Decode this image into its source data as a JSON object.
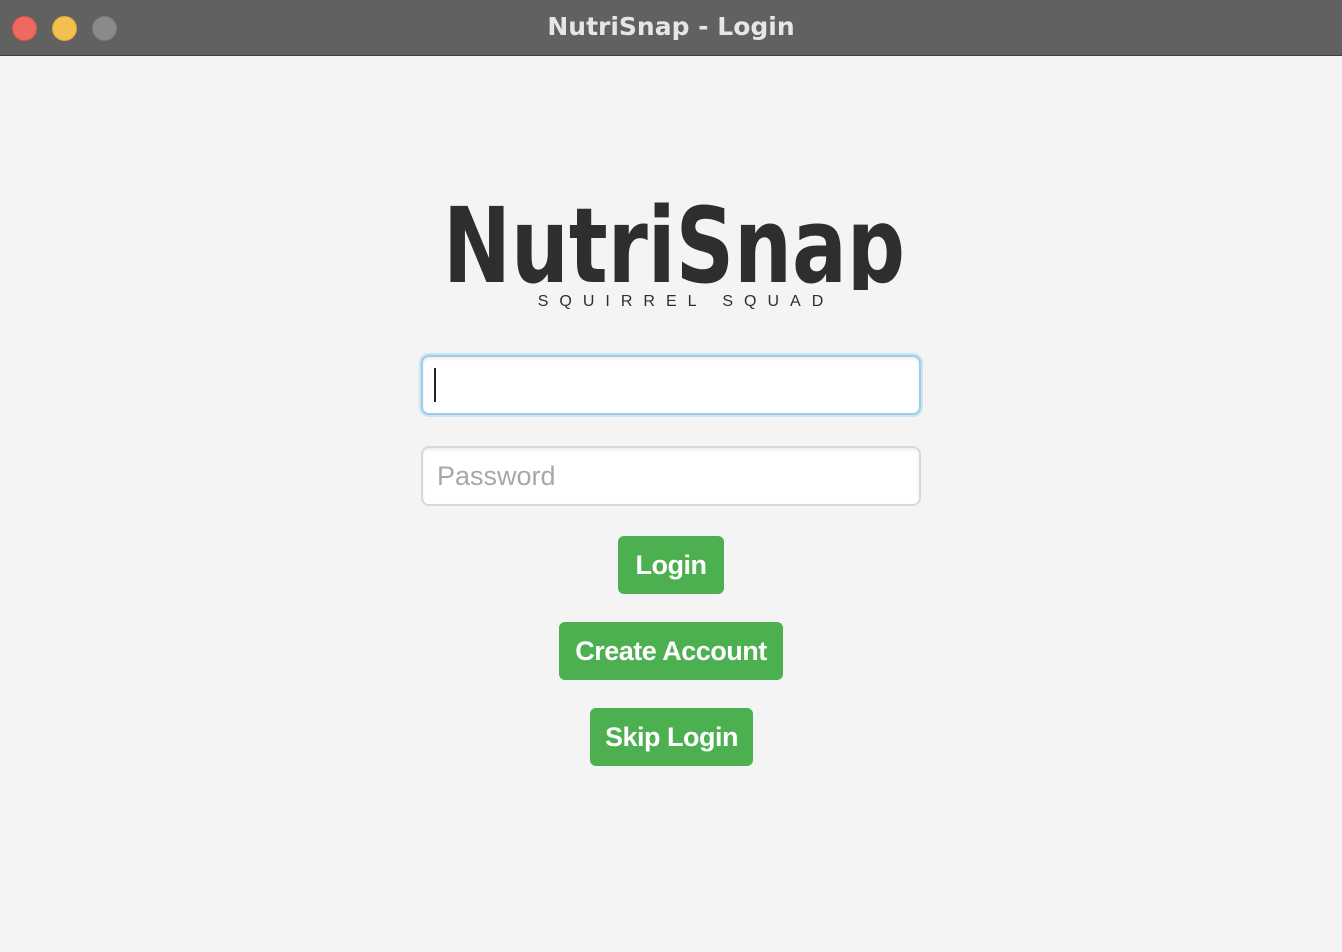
{
  "window": {
    "title": "NutriSnap - Login",
    "controls": [
      "close",
      "minimize",
      "zoom"
    ]
  },
  "logo": {
    "wordmark": "NutriSnap",
    "tagline": "SQUIRREL SQUAD"
  },
  "form": {
    "username": {
      "value": "",
      "placeholder": ""
    },
    "password": {
      "value": "",
      "placeholder": "Password"
    }
  },
  "buttons": {
    "login": "Login",
    "create_account": "Create Account",
    "skip_login": "Skip Login"
  },
  "colors": {
    "titlebar": "#616161",
    "background": "#f4f4f4",
    "button": "#4caf50",
    "logo_text": "#2f2d2e",
    "focus_ring": "#9dcde8"
  },
  "icons": {
    "close": "close-dot-icon",
    "minimize": "minimize-dot-icon",
    "zoom": "zoom-dot-icon"
  }
}
